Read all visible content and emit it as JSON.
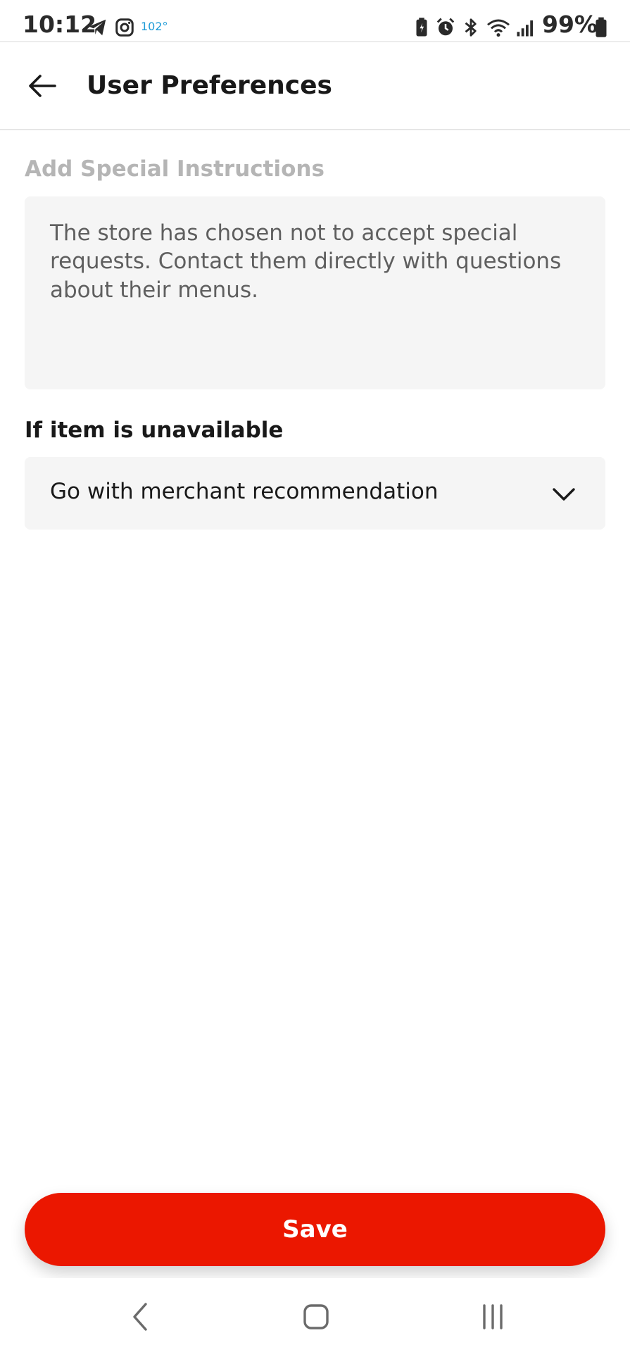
{
  "status_bar": {
    "time": "10:12",
    "temperature": "102°",
    "battery_percent": "99%",
    "icons": [
      "telegram-icon",
      "instagram-icon",
      "battery-saver-icon",
      "alarm-icon",
      "bluetooth-icon",
      "wifi-icon",
      "signal-icon",
      "battery-icon"
    ]
  },
  "header": {
    "back_icon": "arrow-left-icon",
    "title": "User Preferences"
  },
  "special_instructions": {
    "label": "Add Special Instructions",
    "message": "The store has chosen not to accept special requests. Contact them directly with questions about their menus."
  },
  "unavailable": {
    "label": "If item is unavailable",
    "selected": "Go with merchant recommendation",
    "chevron_icon": "chevron-down-icon"
  },
  "actions": {
    "save_label": "Save"
  },
  "nav": {
    "back_icon": "nav-back-icon",
    "home_icon": "nav-home-icon",
    "recents_icon": "nav-recents-icon"
  },
  "colors": {
    "brand_red": "#eb1700",
    "field_bg": "#f5f5f5",
    "muted_text": "#b5b5b5",
    "temp_blue": "#1e9bd7"
  }
}
